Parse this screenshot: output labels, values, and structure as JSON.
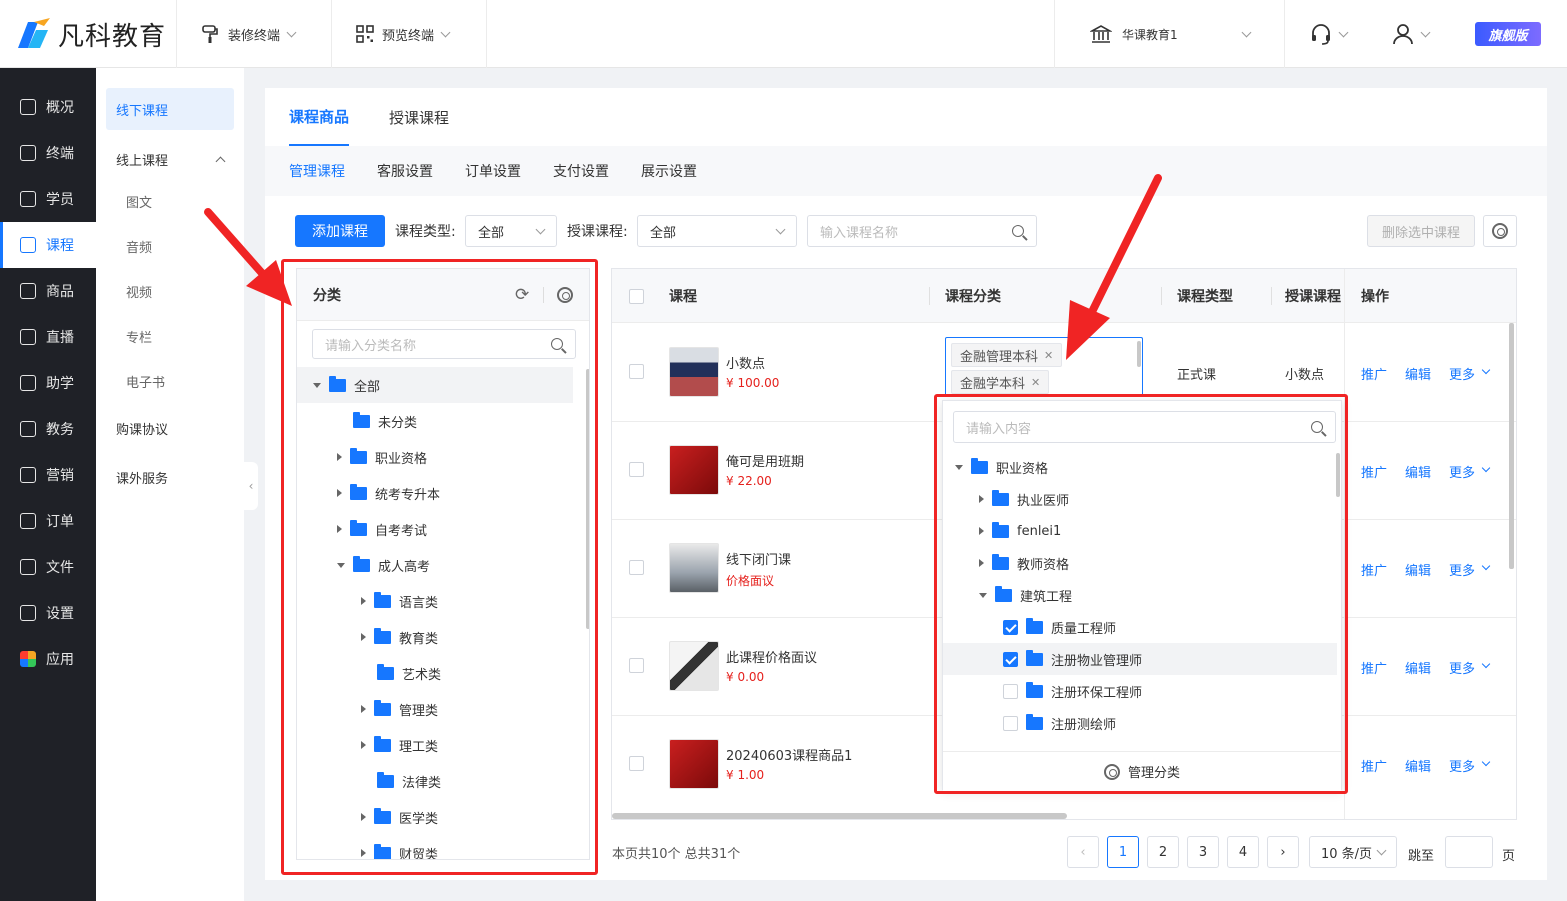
{
  "brand": {
    "logo_text": "凡科教育",
    "edition": "旗舰版"
  },
  "topbar": {
    "decorate": "装修终端",
    "preview": "预览终端",
    "org": "华课教育1"
  },
  "nav": [
    {
      "label": "概况",
      "icon": "overview-icon"
    },
    {
      "label": "终端",
      "icon": "terminal-icon"
    },
    {
      "label": "学员",
      "icon": "students-icon"
    },
    {
      "label": "课程",
      "icon": "course-icon"
    },
    {
      "label": "商品",
      "icon": "goods-icon"
    },
    {
      "label": "直播",
      "icon": "live-icon"
    },
    {
      "label": "助学",
      "icon": "assist-icon"
    },
    {
      "label": "教务",
      "icon": "academic-icon"
    },
    {
      "label": "营销",
      "icon": "marketing-icon"
    },
    {
      "label": "订单",
      "icon": "orders-icon"
    },
    {
      "label": "文件",
      "icon": "files-icon"
    },
    {
      "label": "设置",
      "icon": "settings-icon"
    },
    {
      "label": "应用",
      "icon": "apps-icon"
    }
  ],
  "subnav": {
    "offline": "线下课程",
    "online": "线上课程",
    "online_items": [
      "图文",
      "音频",
      "视频",
      "专栏",
      "电子书"
    ],
    "agreement": "购课协议",
    "extra": "课外服务"
  },
  "tabs1": [
    "课程商品",
    "授课课程"
  ],
  "tabs2": [
    "管理课程",
    "客服设置",
    "订单设置",
    "支付设置",
    "展示设置"
  ],
  "toolbar": {
    "add": "添加课程",
    "type_label": "课程类型:",
    "type_value": "全部",
    "teach_label": "授课课程:",
    "teach_value": "全部",
    "search_placeholder": "输入课程名称",
    "delete": "删除选中课程"
  },
  "category_panel": {
    "title": "分类",
    "search_placeholder": "请输入分类名称",
    "tree": [
      {
        "label": "全部",
        "level": 0,
        "caret": "down"
      },
      {
        "label": "未分类",
        "level": 1,
        "caret": "none"
      },
      {
        "label": "职业资格",
        "level": 1,
        "caret": "right"
      },
      {
        "label": "统考专升本",
        "level": 1,
        "caret": "right"
      },
      {
        "label": "自考考试",
        "level": 1,
        "caret": "right"
      },
      {
        "label": "成人高考",
        "level": 1,
        "caret": "down"
      },
      {
        "label": "语言类",
        "level": 2,
        "caret": "right"
      },
      {
        "label": "教育类",
        "level": 2,
        "caret": "right"
      },
      {
        "label": "艺术类",
        "level": 2,
        "caret": "none"
      },
      {
        "label": "管理类",
        "level": 2,
        "caret": "right"
      },
      {
        "label": "理工类",
        "level": 2,
        "caret": "right"
      },
      {
        "label": "法律类",
        "level": 2,
        "caret": "none"
      },
      {
        "label": "医学类",
        "level": 2,
        "caret": "right"
      },
      {
        "label": "财贸类",
        "level": 2,
        "caret": "right"
      }
    ]
  },
  "table": {
    "headers": [
      "课程",
      "课程分类",
      "课程类型",
      "授课课程",
      "操作"
    ],
    "rows": [
      {
        "name": "小数点",
        "price": "¥ 100.00",
        "type": "正式课",
        "teach": "小数点"
      },
      {
        "name": "俺可是用班期",
        "price": "¥ 22.00",
        "type": "",
        "teach": ""
      },
      {
        "name": "线下闭门课",
        "price": "价格面议",
        "type": "",
        "teach": ""
      },
      {
        "name": "此课程价格面议",
        "price": "¥ 0.00",
        "type": "",
        "teach": ""
      },
      {
        "name": "20240603课程商品1",
        "price": "¥ 1.00",
        "type": "",
        "teach": ""
      }
    ],
    "tags": [
      "金融管理本科",
      "金融学本科"
    ],
    "ops": {
      "promote": "推广",
      "edit": "编辑",
      "more": "更多"
    }
  },
  "dropdown": {
    "search_placeholder": "请输入内容",
    "items": [
      {
        "label": "职业资格",
        "level": 0,
        "caret": "down",
        "check": "none"
      },
      {
        "label": "执业医师",
        "level": 1,
        "caret": "right",
        "check": "none"
      },
      {
        "label": "fenlei1",
        "level": 1,
        "caret": "right",
        "check": "none"
      },
      {
        "label": "教师资格",
        "level": 1,
        "caret": "right",
        "check": "none"
      },
      {
        "label": "建筑工程",
        "level": 1,
        "caret": "down",
        "check": "none"
      },
      {
        "label": "质量工程师",
        "level": 2,
        "caret": "none",
        "check": "on"
      },
      {
        "label": "注册物业管理师",
        "level": 2,
        "caret": "none",
        "check": "on"
      },
      {
        "label": "注册环保工程师",
        "level": 2,
        "caret": "none",
        "check": "off"
      },
      {
        "label": "注册测绘师",
        "level": 2,
        "caret": "none",
        "check": "off"
      }
    ],
    "manage": "管理分类"
  },
  "pagination": {
    "summary": "本页共10个 总共31个",
    "pages": [
      "1",
      "2",
      "3",
      "4"
    ],
    "size": "10 条/页",
    "jump": "跳至",
    "page_unit": "页"
  },
  "colors": {
    "accent": "#1677ff",
    "highlight_red": "#f02424",
    "price_red": "#e5211d",
    "nav_bg": "#1f2127"
  }
}
